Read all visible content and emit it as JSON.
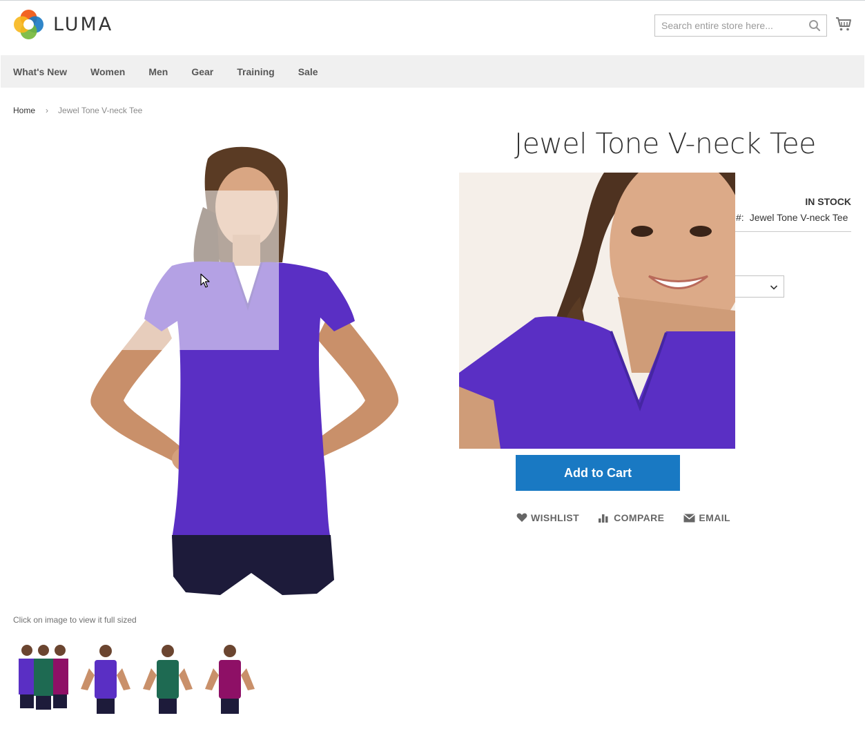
{
  "header": {
    "logo_text": "LUMA",
    "search_placeholder": "Search entire store here...",
    "cart_icon": "cart-icon",
    "search_icon": "search-icon"
  },
  "nav": {
    "items": [
      "What's New",
      "Women",
      "Men",
      "Gear",
      "Training",
      "Sale"
    ]
  },
  "breadcrumb": {
    "home": "Home",
    "separator": "›",
    "current": "Jewel Tone V-neck Tee"
  },
  "gallery": {
    "caption": "Click on image to view it full sized",
    "thumbnails": [
      "purple-green-magenta",
      "purple",
      "green",
      "magenta"
    ]
  },
  "product": {
    "title": "Jewel Tone V-neck Tee",
    "stock": "IN STOCK",
    "sku_label": "#:",
    "sku_value": "Jewel Tone V-neck Tee",
    "add_to_cart": "Add to Cart",
    "actions": {
      "wishlist": "WISHLIST",
      "compare": "COMPARE",
      "email": "EMAIL"
    }
  },
  "colors": {
    "accent": "#1979c3",
    "nav_bg": "#f0f0f0",
    "shirt_purple": "#5a2fc4",
    "shirt_green": "#1e6a52",
    "shirt_magenta": "#8e1066"
  }
}
